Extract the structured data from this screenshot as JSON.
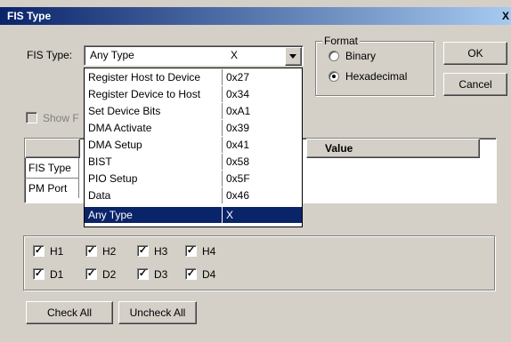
{
  "window": {
    "title": "FIS Type",
    "close_label": "X"
  },
  "fis_type": {
    "label": "FIS Type:",
    "selected_name": "Any Type",
    "selected_value": "X",
    "options": [
      {
        "name": "Register Host to Device",
        "value": "0x27"
      },
      {
        "name": "Register Device to Host",
        "value": "0x34"
      },
      {
        "name": "Set Device Bits",
        "value": "0xA1"
      },
      {
        "name": "DMA Activate",
        "value": "0x39"
      },
      {
        "name": "DMA Setup",
        "value": "0x41"
      },
      {
        "name": "BIST",
        "value": "0x58"
      },
      {
        "name": "PIO Setup",
        "value": "0x5F"
      },
      {
        "name": "Data",
        "value": "0x46"
      },
      {
        "name": "Any Type",
        "value": "X"
      }
    ]
  },
  "format": {
    "title": "Format",
    "options": [
      {
        "label": "Binary",
        "selected": false
      },
      {
        "label": "Hexadecimal",
        "selected": true
      }
    ]
  },
  "buttons": {
    "ok": "OK",
    "cancel": "Cancel",
    "check_all": "Check All",
    "uncheck_all": "Uncheck All"
  },
  "show_partial": "Show F",
  "table": {
    "value_header": "Value",
    "rows": [
      "FIS Type",
      "PM Port"
    ]
  },
  "checkboxes": [
    {
      "label": "H1",
      "checked": true
    },
    {
      "label": "H2",
      "checked": true
    },
    {
      "label": "H3",
      "checked": true
    },
    {
      "label": "H4",
      "checked": true
    },
    {
      "label": "D1",
      "checked": true
    },
    {
      "label": "D2",
      "checked": true
    },
    {
      "label": "D3",
      "checked": true
    },
    {
      "label": "D4",
      "checked": true
    }
  ],
  "colors": {
    "titlebar": "#0a246a",
    "highlight": "#0a246a",
    "face": "#d4d0c8"
  }
}
